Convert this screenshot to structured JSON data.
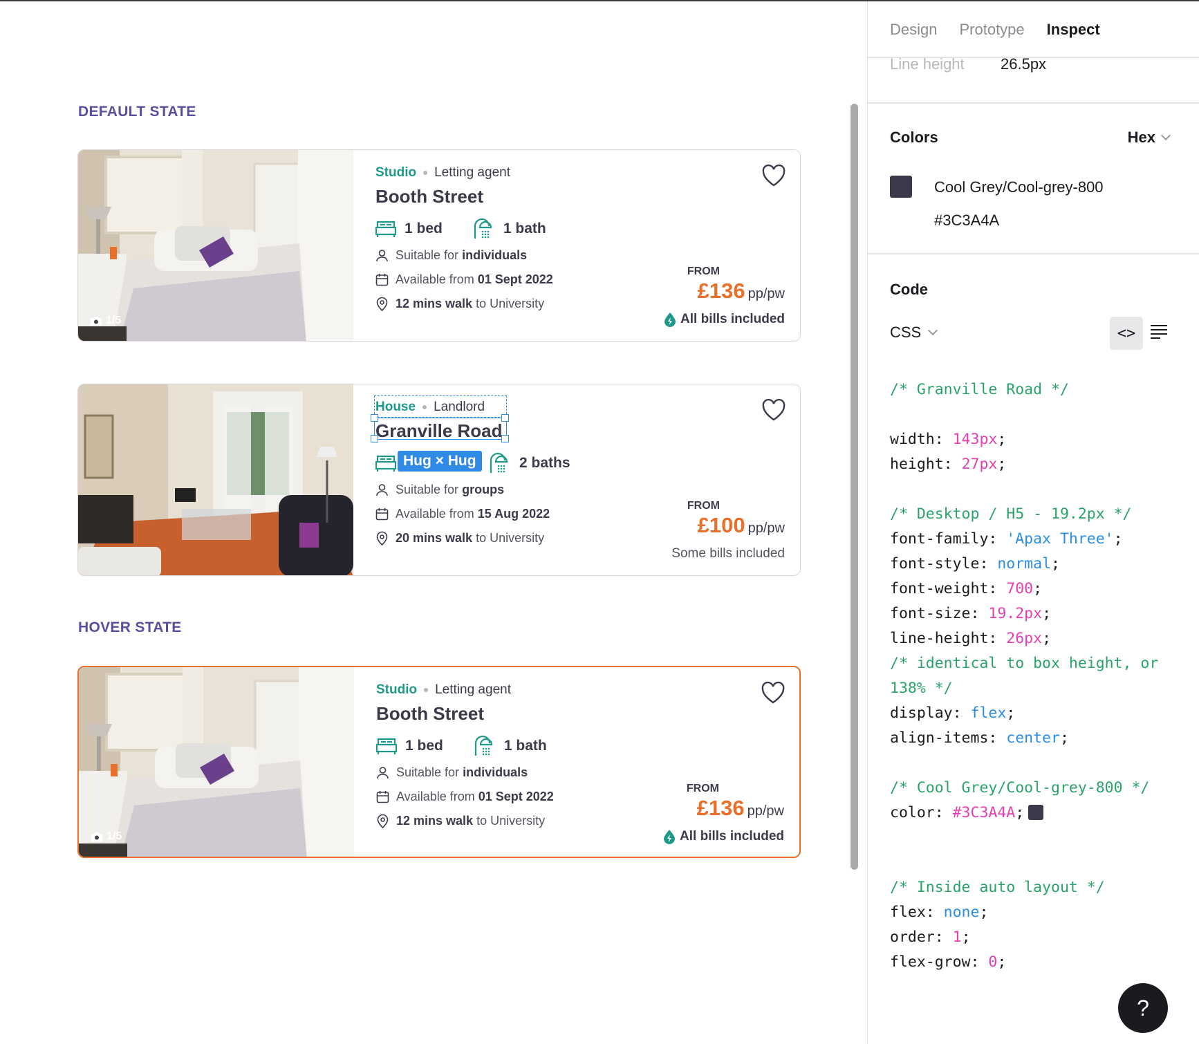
{
  "canvas": {
    "default_label": "DEFAULT STATE",
    "hover_label": "HOVER STATE",
    "cards": [
      {
        "type": "Studio",
        "agent": "Letting agent",
        "street": "Booth Street",
        "beds": "1 bed",
        "baths": "1 bath",
        "photo_count": "1/5",
        "suitable_prefix": "Suitable for",
        "suitable_value": "individuals",
        "available_prefix": "Available from",
        "available_value": "01 Sept 2022",
        "walk_value": "12 mins walk",
        "walk_suffix": "to University",
        "from": "FROM",
        "price": "£136",
        "unit": "pp/pw",
        "bills": "All bills included"
      },
      {
        "type": "House",
        "agent": "Landlord",
        "street": "Granville Road",
        "beds": "",
        "baths": "2 baths",
        "suitable_prefix": "Suitable for",
        "suitable_value": "groups",
        "available_prefix": "Available from",
        "available_value": "15 Aug 2022",
        "walk_value": "20 mins walk",
        "walk_suffix": "to University",
        "from": "FROM",
        "price": "£100",
        "unit": "pp/pw",
        "bills": "Some bills included",
        "selection_tag": "Hug × Hug"
      },
      {
        "type": "Studio",
        "agent": "Letting agent",
        "street": "Booth Street",
        "beds": "1 bed",
        "baths": "1 bath",
        "photo_count": "1/5",
        "suitable_prefix": "Suitable for",
        "suitable_value": "individuals",
        "available_prefix": "Available from",
        "available_value": "01 Sept 2022",
        "walk_value": "12 mins walk",
        "walk_suffix": "to University",
        "from": "FROM",
        "price": "£136",
        "unit": "pp/pw",
        "bills": "All bills included"
      }
    ]
  },
  "panel": {
    "tabs": [
      "Design",
      "Prototype",
      "Inspect"
    ],
    "active_tab": "Inspect",
    "line_height_label": "Line height",
    "line_height_value": "26.5px",
    "colors_title": "Colors",
    "color_format": "Hex",
    "color_name": "Cool Grey/Cool-grey-800",
    "color_hex": "#3C3A4A",
    "code_title": "Code",
    "code_language": "CSS",
    "code_toggle": "<>",
    "code_lines": [
      [
        [
          "c",
          "/* Granville Road */"
        ]
      ],
      [],
      [
        [
          "t",
          "width: "
        ],
        [
          "n",
          "143px"
        ],
        [
          "t",
          ";"
        ]
      ],
      [
        [
          "t",
          "height: "
        ],
        [
          "n",
          "27px"
        ],
        [
          "t",
          ";"
        ]
      ],
      [],
      [
        [
          "c",
          "/* Desktop / H5 - 19.2px */"
        ]
      ],
      [
        [
          "t",
          "font-family: "
        ],
        [
          "k",
          "'Apax Three'"
        ],
        [
          "t",
          ";"
        ]
      ],
      [
        [
          "t",
          "font-style: "
        ],
        [
          "k",
          "normal"
        ],
        [
          "t",
          ";"
        ]
      ],
      [
        [
          "t",
          "font-weight: "
        ],
        [
          "n",
          "700"
        ],
        [
          "t",
          ";"
        ]
      ],
      [
        [
          "t",
          "font-size: "
        ],
        [
          "n",
          "19.2px"
        ],
        [
          "t",
          ";"
        ]
      ],
      [
        [
          "t",
          "line-height: "
        ],
        [
          "n",
          "26px"
        ],
        [
          "t",
          ";"
        ]
      ],
      [
        [
          "c",
          "/* identical to box height, or"
        ]
      ],
      [
        [
          "c",
          "138% */"
        ]
      ],
      [
        [
          "t",
          "display: "
        ],
        [
          "k",
          "flex"
        ],
        [
          "t",
          ";"
        ]
      ],
      [
        [
          "t",
          "align-items: "
        ],
        [
          "k",
          "center"
        ],
        [
          "t",
          ";"
        ]
      ],
      [],
      [
        [
          "c",
          "/* Cool Grey/Cool-grey-800 */"
        ]
      ],
      [
        [
          "t",
          "color: "
        ],
        [
          "n",
          "#3C3A4A"
        ],
        [
          "t",
          ";"
        ],
        [
          "s",
          ""
        ]
      ],
      [],
      [],
      [
        [
          "c",
          "/* Inside auto layout */"
        ]
      ],
      [
        [
          "t",
          "flex: "
        ],
        [
          "k",
          "none"
        ],
        [
          "t",
          ";"
        ]
      ],
      [
        [
          "t",
          "order: "
        ],
        [
          "n",
          "1"
        ],
        [
          "t",
          ";"
        ]
      ],
      [
        [
          "t",
          "flex-grow: "
        ],
        [
          "n",
          "0"
        ],
        [
          "t",
          ";"
        ]
      ]
    ],
    "help_label": "?"
  },
  "colors": {
    "accent_orange": "#e8702a",
    "teal": "#1f9a8a",
    "selection_blue": "#2f8be6",
    "label_purple": "#5b4e9c",
    "text_dark": "#3C3A4A"
  },
  "icons": [
    "bed-icon",
    "shower-icon",
    "person-icon",
    "calendar-icon",
    "location-pin-icon",
    "heart-icon",
    "camera-icon",
    "bolt-drop-icon",
    "chevron-down-icon",
    "code-icon",
    "list-icon",
    "help-icon"
  ]
}
